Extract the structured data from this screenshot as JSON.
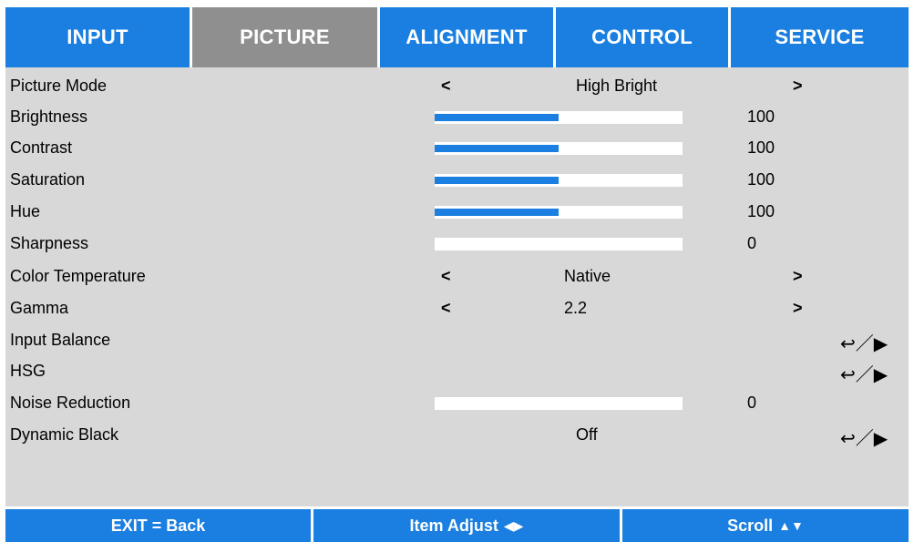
{
  "tabs": [
    {
      "label": "INPUT",
      "active": false
    },
    {
      "label": "PICTURE",
      "active": true
    },
    {
      "label": "ALIGNMENT",
      "active": false
    },
    {
      "label": "CONTROL",
      "active": false
    },
    {
      "label": "SERVICE",
      "active": false
    }
  ],
  "rows": {
    "picture_mode": {
      "label": "Picture Mode",
      "left": "<",
      "value": "High Bright",
      "right": ">"
    },
    "brightness": {
      "label": "Brightness",
      "value": "100",
      "level": 0.5
    },
    "contrast": {
      "label": "Contrast",
      "value": "100",
      "level": 0.5
    },
    "saturation": {
      "label": "Saturation",
      "value": "100",
      "level": 0.5
    },
    "hue": {
      "label": "Hue",
      "value": "100",
      "level": 0.5
    },
    "sharpness": {
      "label": "Sharpness",
      "value": "0",
      "level": 0
    },
    "color_temperature": {
      "label": "Color Temperature",
      "left": "<",
      "value": "Native",
      "right": ">"
    },
    "gamma": {
      "label": "Gamma",
      "left": "<",
      "value": "2.2",
      "right": ">"
    },
    "input_balance": {
      "label": "Input Balance",
      "action": "↩／▶"
    },
    "hsg": {
      "label": "HSG",
      "action": "↩／▶"
    },
    "noise_reduction": {
      "label": "Noise Reduction",
      "value": "0",
      "level": 0
    },
    "dynamic_black": {
      "label": "Dynamic Black",
      "value": "Off",
      "action": "↩／▶"
    }
  },
  "footer": {
    "exit": "EXIT = Back",
    "adjust": "Item Adjust",
    "adjust_symbol": "◀▶",
    "scroll": "Scroll",
    "scroll_symbol": "▲▼"
  },
  "colors": {
    "accent": "#1a7fe0",
    "active_tab": "#8f8f8f",
    "panel": "#d8d8d8"
  },
  "icons": {
    "enter": "enter-icon",
    "play": "play-icon"
  }
}
